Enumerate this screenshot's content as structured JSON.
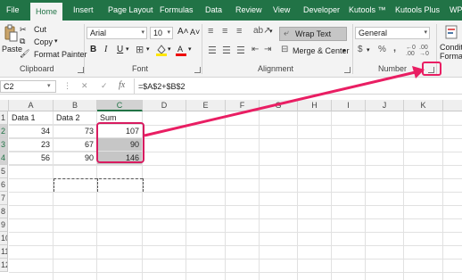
{
  "tabs": [
    "File",
    "Home",
    "Insert",
    "Page Layout",
    "Formulas",
    "Data",
    "Review",
    "View",
    "Developer",
    "Kutools ™",
    "Kutools Plus",
    "WPS"
  ],
  "active_tab": "Home",
  "clipboard": {
    "cut": "Cut",
    "copy": "Copy",
    "paste": "Paste",
    "format_painter": "Format Painter",
    "label": "Clipboard"
  },
  "font": {
    "name": "Arial",
    "size": "10",
    "bold": "B",
    "italic": "I",
    "underline": "U",
    "label": "Font"
  },
  "alignment": {
    "wrap_text": "Wrap Text",
    "merge_center": "Merge & Center",
    "label": "Alignment"
  },
  "number": {
    "format": "General",
    "currency": "$",
    "percent": "%",
    "comma": ",",
    "label": "Number"
  },
  "styles_partial": [
    "Conditi",
    "Formatt"
  ],
  "formula_bar": {
    "name_box": "C2",
    "fx": "fx",
    "formula": "=$A$2+$B$2"
  },
  "columns": [
    "A",
    "B",
    "C",
    "D",
    "E",
    "F",
    "G",
    "H",
    "I",
    "J",
    "K"
  ],
  "rows": [
    "1",
    "2",
    "3",
    "4",
    "5",
    "6",
    "7",
    "8",
    "9",
    "10",
    "11",
    "12"
  ],
  "cells": {
    "A1": "Data 1",
    "B1": "Data 2",
    "C1": "Sum",
    "A2": "34",
    "B2": "73",
    "C2": "107",
    "A3": "23",
    "B3": "67",
    "C3": "90",
    "A4": "56",
    "B4": "90",
    "C4": "146"
  },
  "colors": {
    "ribbon_green": "#217346",
    "highlight_pink": "#e91e63"
  }
}
